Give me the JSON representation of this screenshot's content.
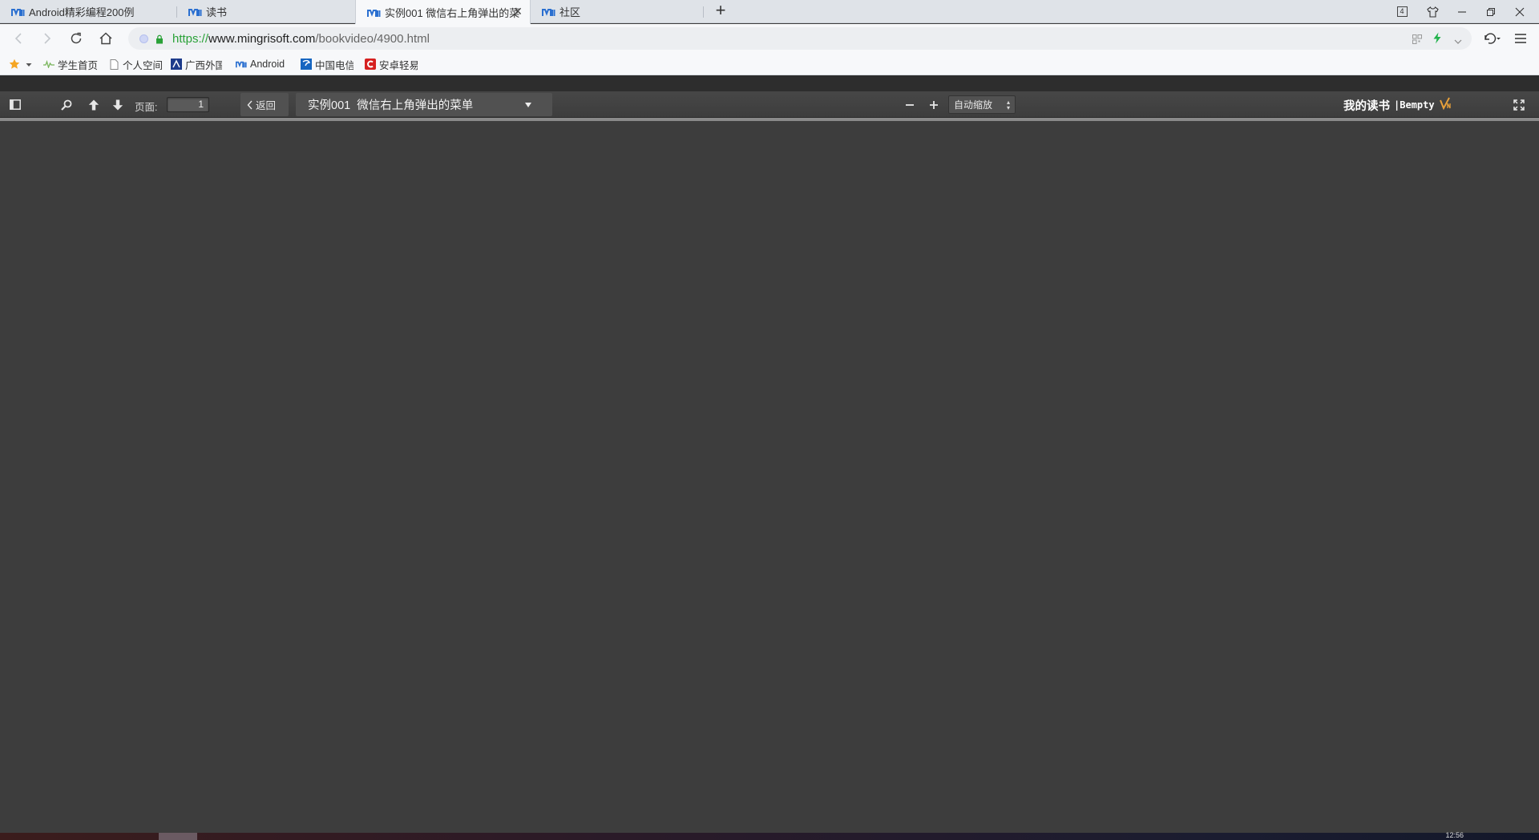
{
  "tabs": [
    {
      "label": "Android精彩编程200例",
      "active": false
    },
    {
      "label": "读书",
      "active": false
    },
    {
      "label": "实例001 微信右上角弹出的菜",
      "active": true
    },
    {
      "label": "社区",
      "active": false
    }
  ],
  "window": {
    "tab_count": "4"
  },
  "address": {
    "protocol": "https://",
    "host": "www.mingrisoft.com",
    "path": "/bookvideo/4900.html"
  },
  "bookmarks": [
    "学生首页",
    "个人空间",
    "广西外国",
    "Android",
    "中国电信",
    "安卓轻易"
  ],
  "viewer": {
    "page_label": "页面:",
    "page_number": "1",
    "back_label": "返回",
    "chapter_title": "实例001  微信右上角弹出的菜单",
    "zoom_value": "自动缩放",
    "brand_mine": "我的读书",
    "brand_user": "|Bempty"
  },
  "taskbar": {
    "clock": "12:56"
  },
  "colors": {
    "viewer_bg": "#3d3d3d",
    "toolbar_bg": "#474747",
    "secure_green": "#2aa138",
    "brand_logo_orange": "#e8a13a",
    "tab_favicon_blue": "#2a6fd0"
  }
}
